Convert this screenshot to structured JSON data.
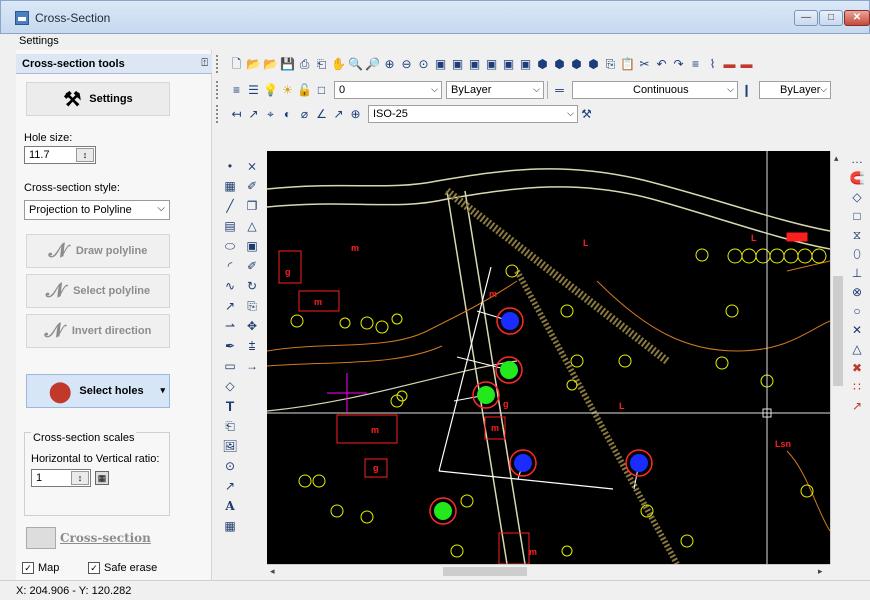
{
  "window": {
    "title": "Cross-Section",
    "controls": {
      "minimize": "—",
      "maximize": "□",
      "close": "✕"
    }
  },
  "tabs": [
    {
      "label": "Settings"
    }
  ],
  "panel": {
    "header": "Cross-section tools",
    "settings_button": "Settings",
    "hole_size_label": "Hole size:",
    "hole_size_value": "11.7",
    "style_label": "Cross-section style:",
    "style_value": "Projection to Polyline",
    "draw_polyline": "Draw polyline",
    "select_polyline": "Select polyline",
    "invert_direction": "Invert direction",
    "select_holes": "Select holes",
    "scales_title": "Cross-section scales",
    "ratio_label": "Horizontal to Vertical ratio:",
    "ratio_value": "1",
    "cross_section_button": "Cross-section",
    "map_checkbox": {
      "label": "Map",
      "checked": true
    },
    "safe_erase_checkbox": {
      "label": "Safe erase",
      "checked": true
    }
  },
  "toolbar": {
    "layer_value": "0",
    "color_value": "ByLayer",
    "linetype_value": "Continuous",
    "lineweight_value": "ByLayer",
    "dimstyle_value": "ISO-25"
  },
  "status": {
    "coordinates": "X: 204.906  -  Y: 120.282"
  },
  "colors": {
    "canvas_bg": "#000000",
    "hole_blue": "#1a2cff",
    "hole_green": "#22e81c",
    "hole_ring": "#ff2a2a",
    "building": "#ff1e1e",
    "road": "#d8d8b0",
    "contour": "#d07a20",
    "trees": "#e8f000"
  },
  "map_labels": [
    "m",
    "L",
    "g",
    "m",
    "m",
    "L",
    "g",
    "m",
    "m",
    "L",
    "Lsn",
    "m",
    "g"
  ]
}
